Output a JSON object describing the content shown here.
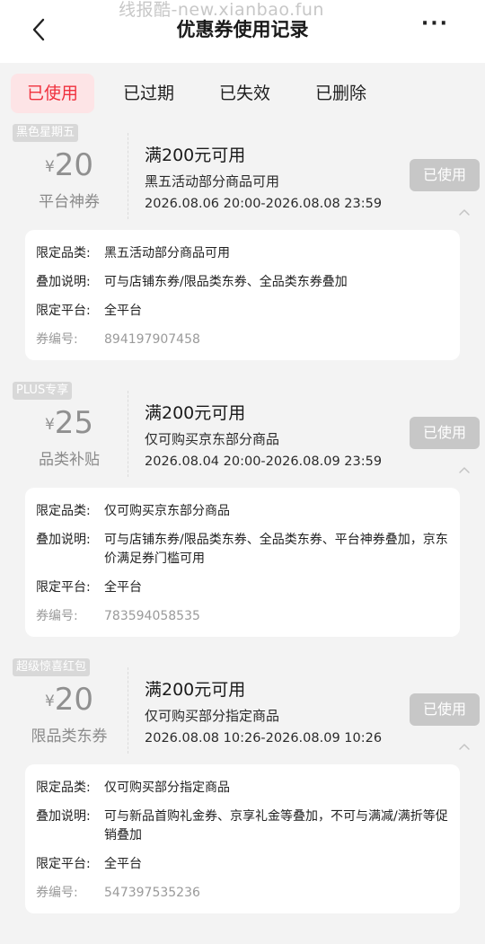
{
  "watermark": "线报酷-new.xianbao.fun",
  "header": {
    "title": "优惠券使用记录",
    "more": "···"
  },
  "tabs": [
    {
      "label": "已使用",
      "active": true
    },
    {
      "label": "已过期",
      "active": false
    },
    {
      "label": "已失效",
      "active": false
    },
    {
      "label": "已删除",
      "active": false
    }
  ],
  "colors": {
    "accent": "#f0303d",
    "active_tab_bg": "#fde4e6",
    "badge_grey": "#c7c7c7"
  },
  "labels": {
    "category": "限定品类:",
    "stack": "叠加说明:",
    "platform": "限定平台:",
    "serial": "券编号:"
  },
  "coupons": [
    {
      "tag": "黑色星期五",
      "currency": "¥",
      "amount": "20",
      "type": "平台神券",
      "condition": "满200元可用",
      "description": "黑五活动部分商品可用",
      "validity": "2026.08.06 20:00-2026.08.08 23:59",
      "status": "已使用",
      "category": "黑五活动部分商品可用",
      "stack": "可与店铺东券/限品类东券、全品类东券叠加",
      "platform": "全平台",
      "serial": "894197907458"
    },
    {
      "tag": "PLUS专享",
      "currency": "¥",
      "amount": "25",
      "type": "品类补贴",
      "condition": "满200元可用",
      "description": "仅可购买京东部分商品",
      "validity": "2026.08.04 20:00-2026.08.09 23:59",
      "status": "已使用",
      "category": "仅可购买京东部分商品",
      "stack": "可与店铺东券/限品类东券、全品类东券、平台神券叠加，京东价满足券门槛可用",
      "platform": "全平台",
      "serial": "783594058535"
    },
    {
      "tag": "超级惊喜红包",
      "currency": "¥",
      "amount": "20",
      "type": "限品类东券",
      "condition": "满200元可用",
      "description": "仅可购买部分指定商品",
      "validity": "2026.08.08 10:26-2026.08.09 10:26",
      "status": "已使用",
      "category": "仅可购买部分指定商品",
      "stack": "可与新品首购礼金券、京享礼金等叠加，不可与满减/满折等促销叠加",
      "platform": "全平台",
      "serial": "547397535236"
    }
  ]
}
